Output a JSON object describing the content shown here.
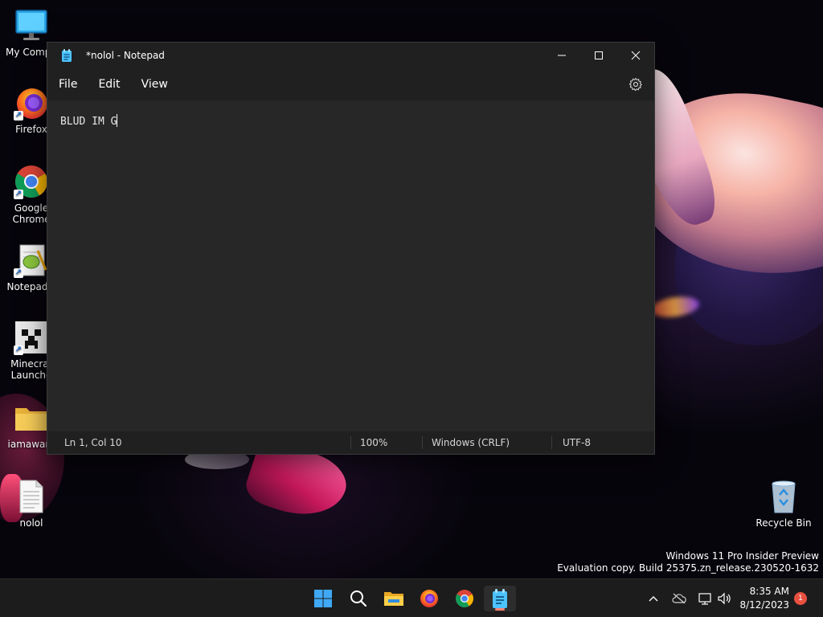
{
  "desktop": {
    "icons": [
      {
        "label": "My Compu"
      },
      {
        "label": "Firefox"
      },
      {
        "label": "Google Chrome",
        "line1": "Google",
        "line2": "Chrome"
      },
      {
        "label": "Notepad+",
        "line1": "Notepad+"
      },
      {
        "label": "Minecraft Launcher",
        "line1": "Minecraf",
        "line2": "Launche"
      },
      {
        "label": "iamaware"
      },
      {
        "label": "nolol"
      }
    ],
    "recycle_bin": "Recycle Bin",
    "watermark": {
      "line1": "Windows 11 Pro Insider Preview",
      "line2": "Evaluation copy. Build 25375.zn_release.230520-1632"
    }
  },
  "notepad": {
    "title": "*nolol - Notepad",
    "menu": {
      "file": "File",
      "edit": "Edit",
      "view": "View"
    },
    "content": "BLUD IM G",
    "status": {
      "position": "Ln 1, Col 10",
      "zoom": "100%",
      "line_ending": "Windows (CRLF)",
      "encoding": "UTF-8"
    }
  },
  "taskbar": {
    "clock_time": "8:35 AM",
    "clock_date": "8/12/2023",
    "notification_count": "1"
  },
  "colors": {
    "window_bg": "#202020",
    "editor_bg": "#272727",
    "taskbar_bg": "#1c1c1c",
    "accent": "#ff7f6e",
    "badge": "#e8503f"
  }
}
